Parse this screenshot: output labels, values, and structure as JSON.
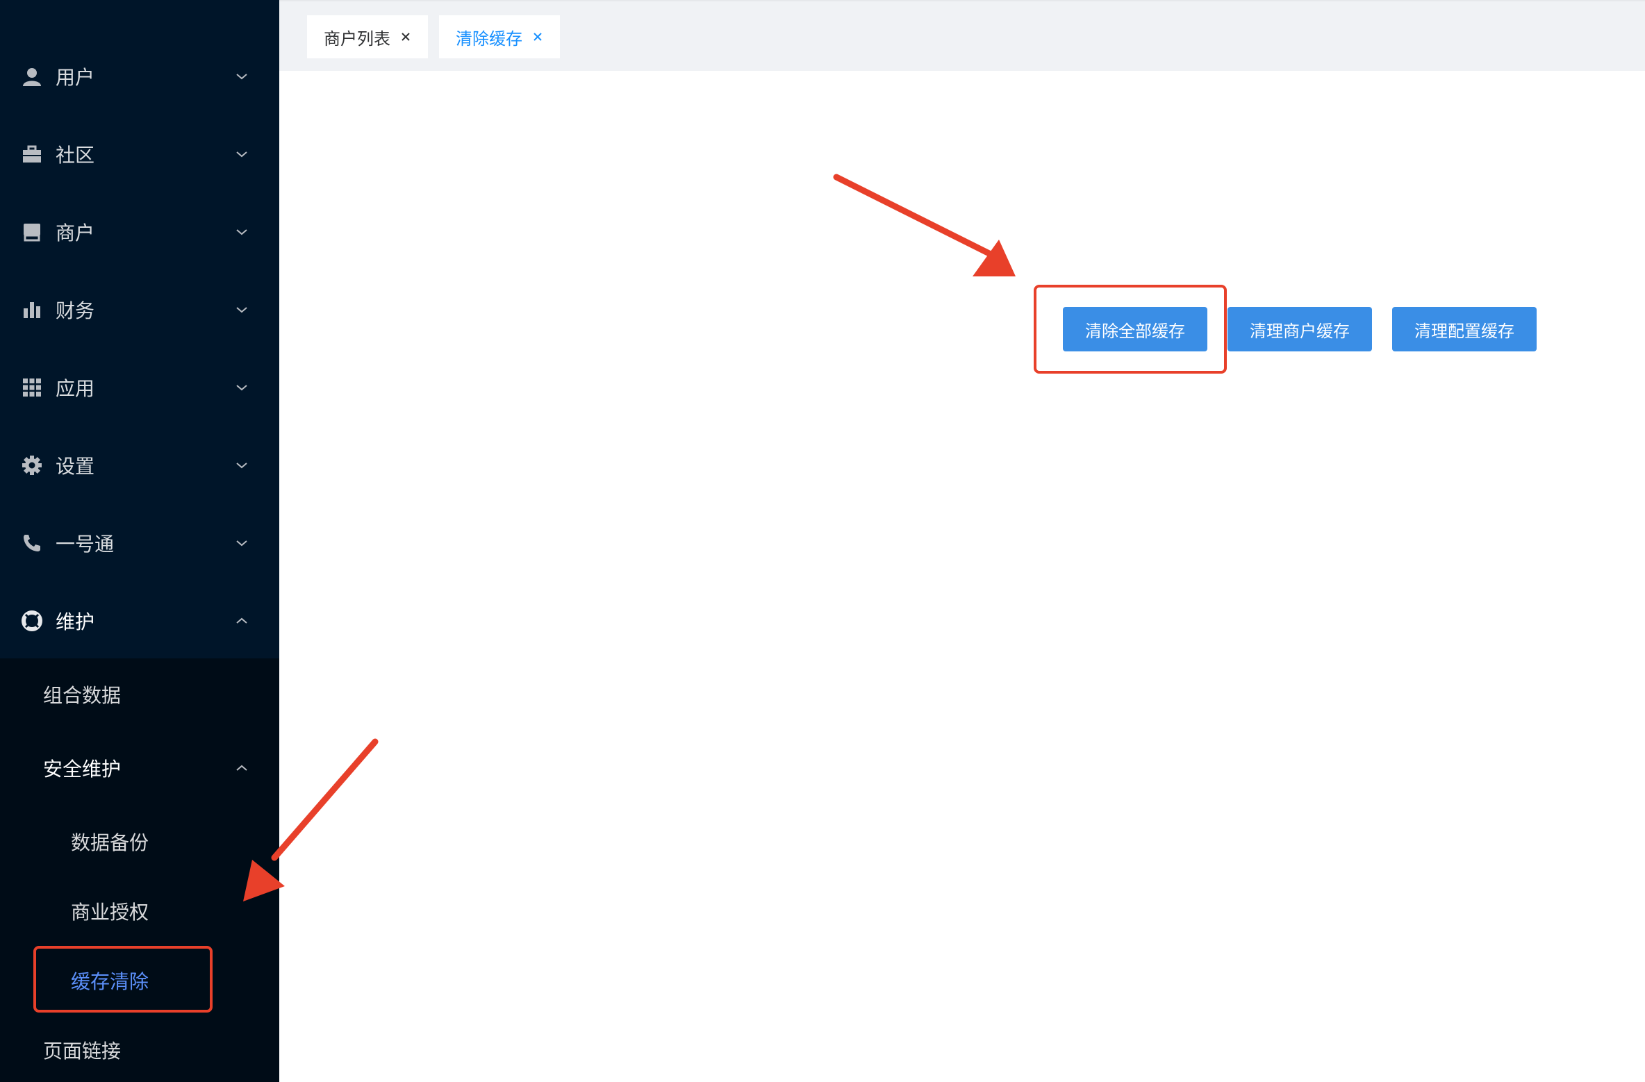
{
  "sidebar": {
    "items": [
      {
        "label": "用户",
        "icon": "user-icon",
        "expanded": false
      },
      {
        "label": "社区",
        "icon": "briefcase-icon",
        "expanded": false
      },
      {
        "label": "商户",
        "icon": "shop-icon",
        "expanded": false
      },
      {
        "label": "财务",
        "icon": "bar-chart-icon",
        "expanded": false
      },
      {
        "label": "应用",
        "icon": "grid-icon",
        "expanded": false
      },
      {
        "label": "设置",
        "icon": "gear-icon",
        "expanded": false
      },
      {
        "label": "一号通",
        "icon": "phone-icon",
        "expanded": false
      },
      {
        "label": "维护",
        "icon": "lifebuoy-icon",
        "expanded": true
      }
    ],
    "submenu": {
      "combined_data": "组合数据",
      "security": {
        "label": "安全维护",
        "expanded": true,
        "children": [
          {
            "label": "数据备份",
            "active": false
          },
          {
            "label": "商业授权",
            "active": false
          },
          {
            "label": "缓存清除",
            "active": true
          }
        ]
      },
      "page_links": "页面链接"
    }
  },
  "tabs": [
    {
      "label": "商户列表",
      "active": false
    },
    {
      "label": "清除缓存",
      "active": true
    }
  ],
  "buttons": {
    "clear_all": "清除全部缓存",
    "clear_merchant": "清理商户缓存",
    "clear_config": "清理配置缓存"
  },
  "colors": {
    "sidebar_bg": "#001529",
    "submenu_bg": "#000c17",
    "primary": "#3a8ee6",
    "active_link": "#5b8ff9",
    "annotation": "#e8402a"
  }
}
